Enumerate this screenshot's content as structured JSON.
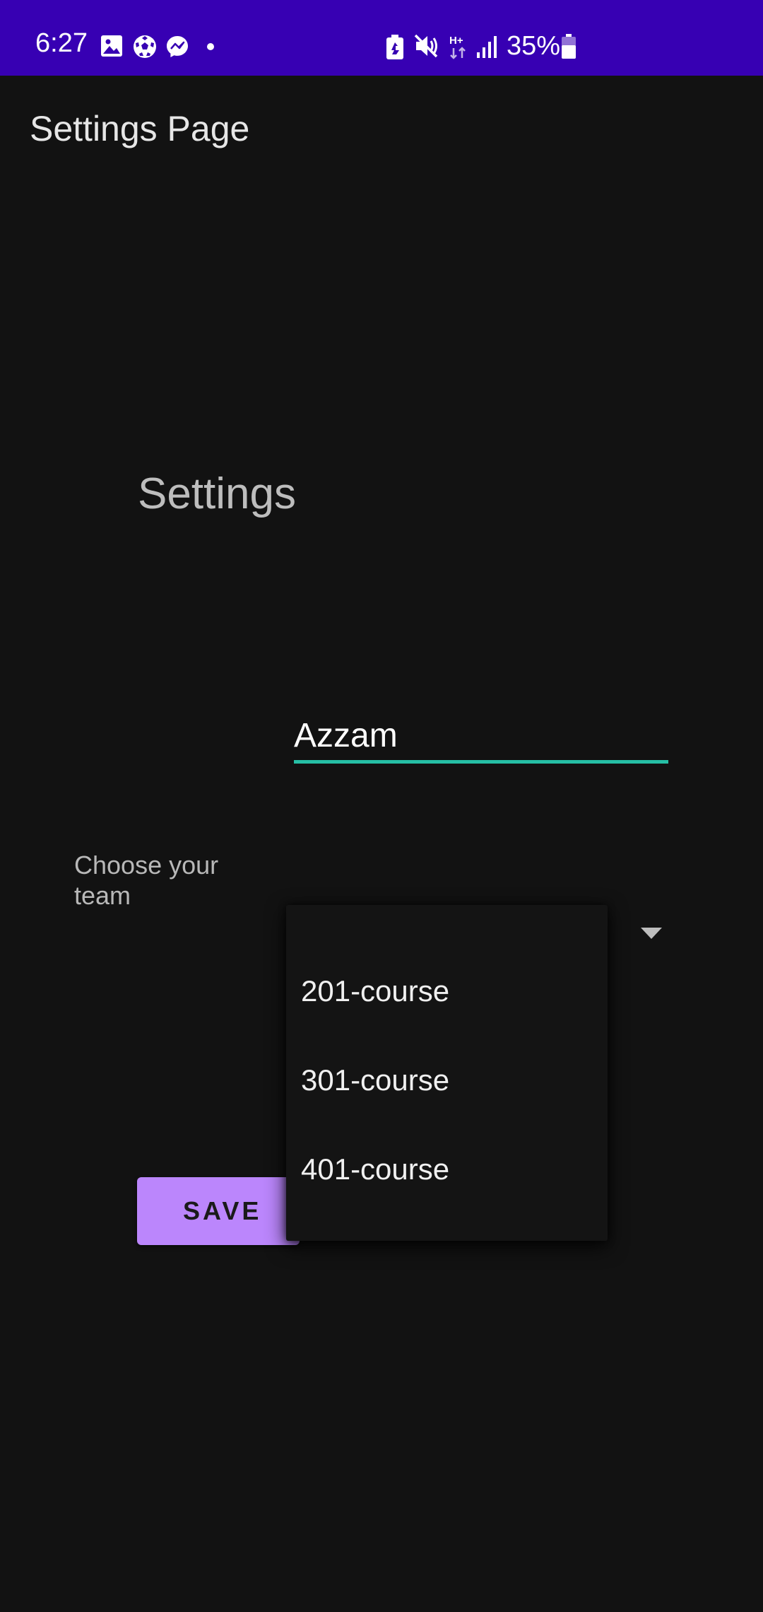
{
  "status_bar": {
    "time": "6:27",
    "battery": "35%",
    "background": "#3700b3",
    "icons": [
      "gallery-icon",
      "soccer-ball-icon",
      "messenger-icon",
      "notification-dot-icon",
      "battery-saver-icon",
      "mute-icon",
      "data-hplus-icon",
      "signal-icon",
      "battery-icon"
    ]
  },
  "app_bar": {
    "title": "Settings Page"
  },
  "content": {
    "heading": "Settings",
    "name_field": {
      "value": "Azzam",
      "underline_color": "#26bfa5"
    },
    "team_label": "Choose your team",
    "save_label": "SAVE",
    "save_color": "#bb86fc"
  },
  "dropdown": {
    "options": [
      "201-course",
      "301-course",
      "401-course"
    ]
  }
}
